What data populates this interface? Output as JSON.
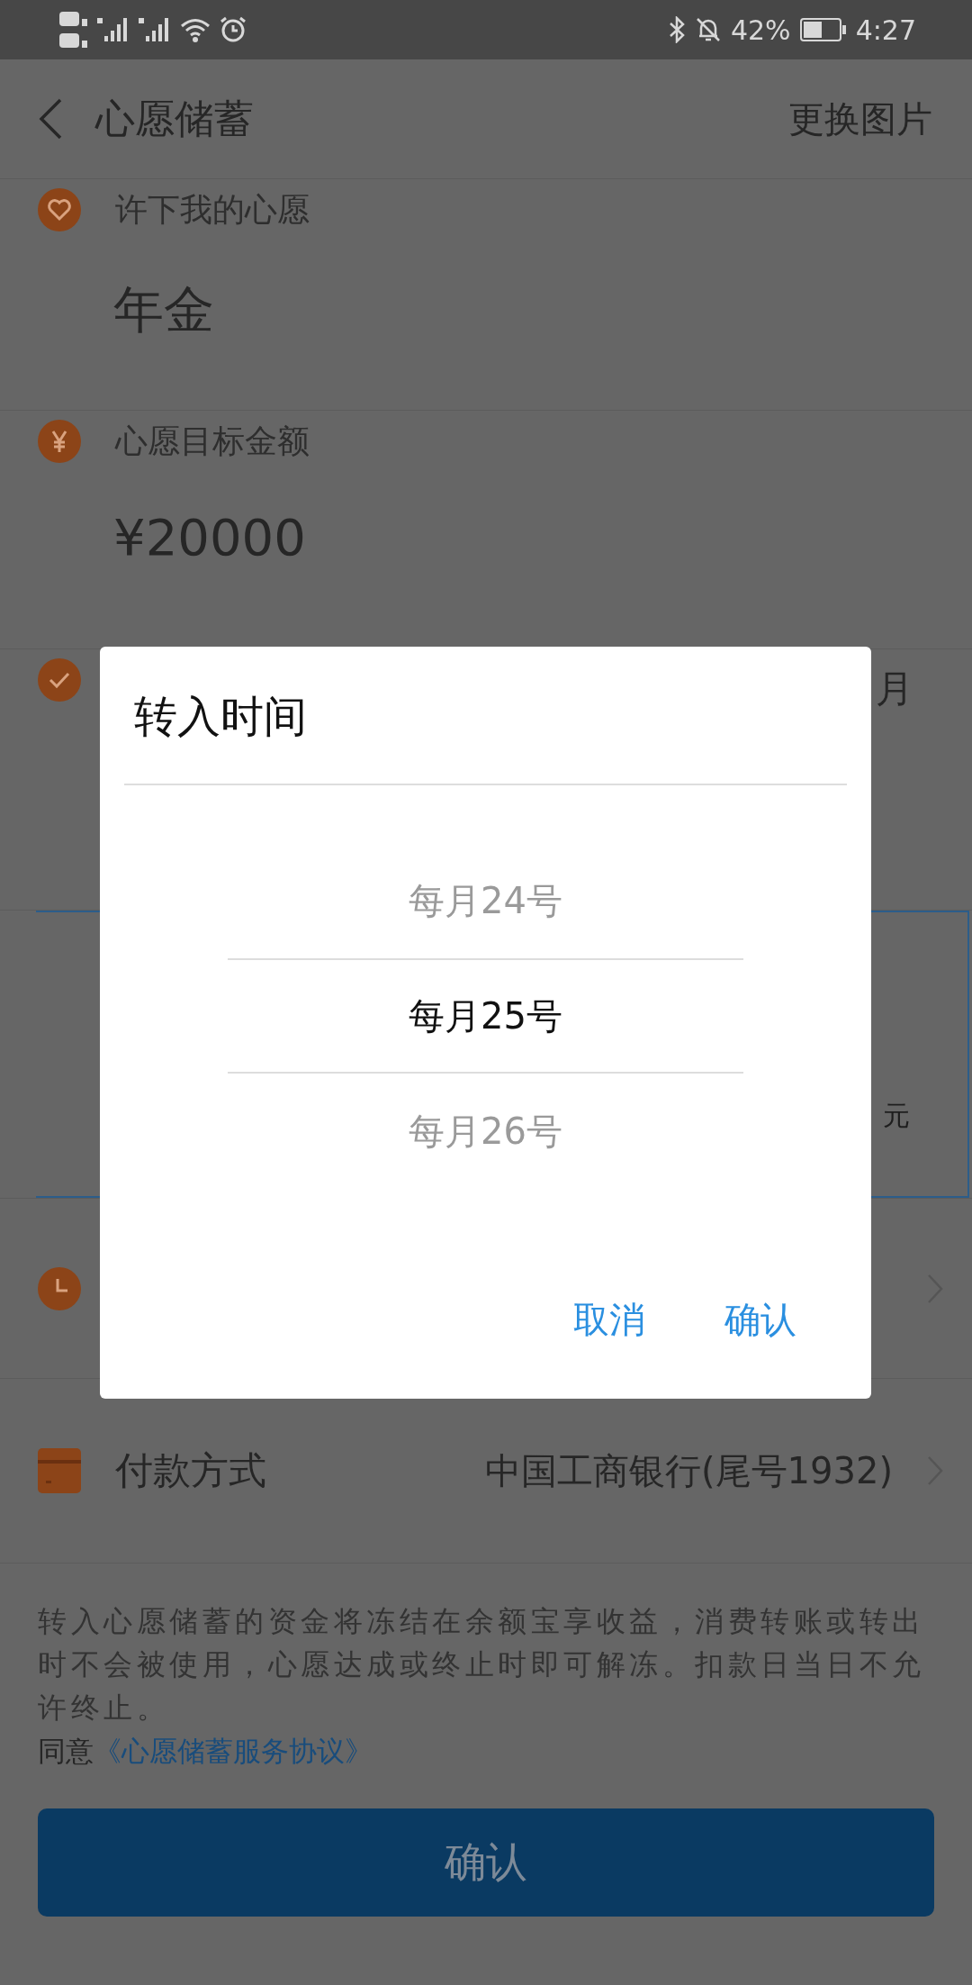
{
  "status_bar": {
    "battery": "42%",
    "time": "4:27"
  },
  "header": {
    "title": "心愿储蓄",
    "action": "更换图片"
  },
  "sections": [
    {
      "kind": "wish",
      "label": "许下我的心愿",
      "value": "年金"
    },
    {
      "kind": "amount",
      "label": "心愿目标金额",
      "value": "¥20000"
    },
    {
      "kind": "period",
      "fragment": "月"
    }
  ],
  "plan_box": {
    "fragment": "元"
  },
  "rows": [
    {
      "kind": "time"
    },
    {
      "kind": "payment",
      "label": "付款方式",
      "value": "中国工商银行(尾号1932)"
    }
  ],
  "notice": "转入心愿储蓄的资金将冻结在余额宝享收益，消费转账或转出时不会被使用，心愿达成或终止时即可解冻。扣款日当日不允许终止。",
  "agreement": {
    "prefix": "同意",
    "link": "《心愿储蓄服务协议》"
  },
  "confirm_button": "确认",
  "dialog": {
    "title": "转入时间",
    "options": [
      {
        "label": "每月24号",
        "selected": false
      },
      {
        "label": "每月25号",
        "selected": true
      },
      {
        "label": "每月26号",
        "selected": false
      }
    ],
    "buttons": [
      "取消",
      "确认"
    ]
  }
}
